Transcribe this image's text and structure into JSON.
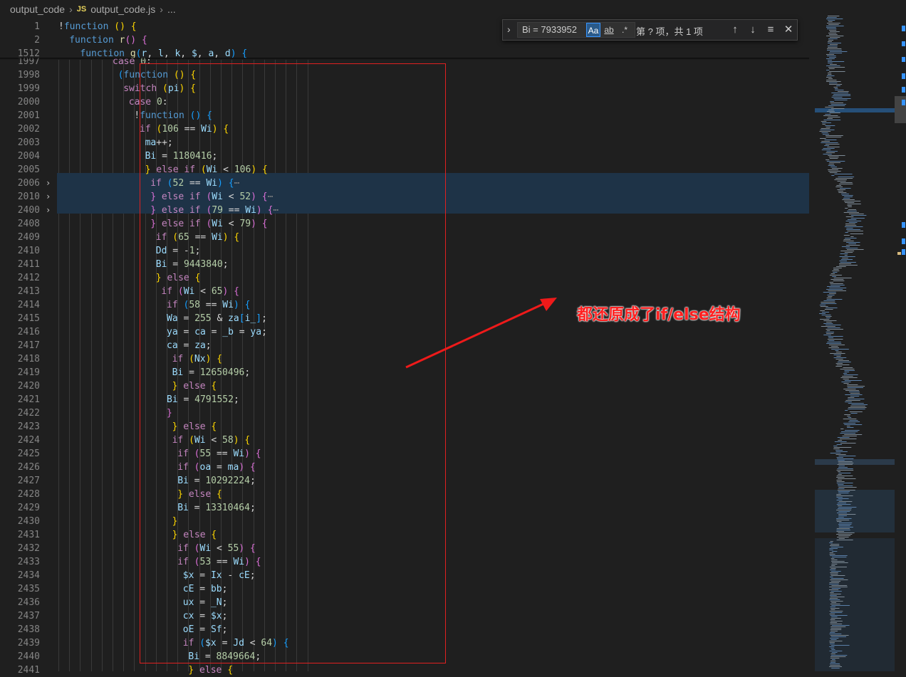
{
  "breadcrumb": {
    "folder": "output_code",
    "file_badge": "JS",
    "file": "output_code.js",
    "tail": "..."
  },
  "sticky": [
    {
      "num": "1",
      "code": "!function () {"
    },
    {
      "num": "2",
      "code": "function r() {"
    },
    {
      "num": "1512",
      "code": "function g(r, l, k, $, a, d) {"
    }
  ],
  "lines": [
    {
      "num": "1997",
      "code": "case 0:"
    },
    {
      "num": "1998",
      "code": "(function () {"
    },
    {
      "num": "1999",
      "code": "switch (pi) {"
    },
    {
      "num": "2000",
      "code": "case 0:"
    },
    {
      "num": "2001",
      "code": "!function () {"
    },
    {
      "num": "2002",
      "code": "if (106 == Wi) {"
    },
    {
      "num": "2003",
      "code": "ma++;"
    },
    {
      "num": "2004",
      "code": "Bi = 1180416;"
    },
    {
      "num": "2005",
      "code": "} else if (Wi < 106) {"
    },
    {
      "num": "2006",
      "code": "if (52 == Wi) {⋯"
    },
    {
      "num": "2010",
      "code": "} else if (Wi < 52) {⋯"
    },
    {
      "num": "2400",
      "code": "} else if (79 == Wi) {⋯"
    },
    {
      "num": "2408",
      "code": "} else if (Wi < 79) {"
    },
    {
      "num": "2409",
      "code": "if (65 == Wi) {"
    },
    {
      "num": "2410",
      "code": "Dd = -1;"
    },
    {
      "num": "2411",
      "code": "Bi = 9443840;"
    },
    {
      "num": "2412",
      "code": "} else {"
    },
    {
      "num": "2413",
      "code": "if (Wi < 65) {"
    },
    {
      "num": "2414",
      "code": "if (58 == Wi) {"
    },
    {
      "num": "2415",
      "code": "Wa = 255 & za[i_];"
    },
    {
      "num": "2416",
      "code": "ya = ca = _b = ya;"
    },
    {
      "num": "2417",
      "code": "ca = za;"
    },
    {
      "num": "2418",
      "code": "if (Nx) {"
    },
    {
      "num": "2419",
      "code": "Bi = 12650496;"
    },
    {
      "num": "2420",
      "code": "} else {"
    },
    {
      "num": "2421",
      "code": "Bi = 4791552;"
    },
    {
      "num": "2422",
      "code": "}"
    },
    {
      "num": "2423",
      "code": "} else {"
    },
    {
      "num": "2424",
      "code": "if (Wi < 58) {"
    },
    {
      "num": "2425",
      "code": "if (55 == Wi) {"
    },
    {
      "num": "2426",
      "code": "if (oa = ma) {"
    },
    {
      "num": "2427",
      "code": "Bi = 10292224;"
    },
    {
      "num": "2428",
      "code": "} else {"
    },
    {
      "num": "2429",
      "code": "Bi = 13310464;"
    },
    {
      "num": "2430",
      "code": "}"
    },
    {
      "num": "2431",
      "code": "} else {"
    },
    {
      "num": "2432",
      "code": "if (Wi < 55) {"
    },
    {
      "num": "2433",
      "code": "if (53 == Wi) {"
    },
    {
      "num": "2434",
      "code": "$x = Ix - cE;"
    },
    {
      "num": "2435",
      "code": "cE = bb;"
    },
    {
      "num": "2436",
      "code": "ux = _N;"
    },
    {
      "num": "2437",
      "code": "cx = $x;"
    },
    {
      "num": "2438",
      "code": "oE = Sf;"
    },
    {
      "num": "2439",
      "code": "if ($x = Jd < 64) {"
    },
    {
      "num": "2440",
      "code": "Bi = 8849664;"
    },
    {
      "num": "2441",
      "code": "} else {"
    }
  ],
  "find": {
    "query": "Bi = 7933952",
    "match_case": "Aa",
    "whole_word": "ab",
    "regex": ".*",
    "result": "第 ? 项，共 1 项"
  },
  "annotation": "都还原成了if/else结构",
  "colors": {
    "background": "#1f1f1f",
    "annotation": "#ff2020",
    "folded_highlight": "#1e3347"
  }
}
